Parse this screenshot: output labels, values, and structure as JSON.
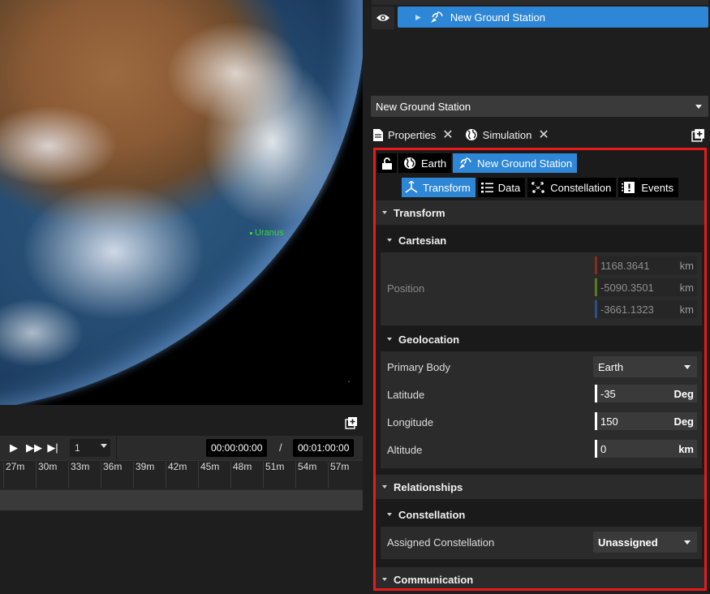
{
  "viewport": {
    "body_label": "Uranus"
  },
  "timeline": {
    "speed": "1",
    "current_time": "00:00:00:00",
    "end_time": "00:01:00:00",
    "ticks": [
      "27m",
      "30m",
      "33m",
      "36m",
      "39m",
      "42m",
      "45m",
      "48m",
      "51m",
      "54m",
      "57m"
    ]
  },
  "scene_tree": {
    "selected_item": "New Ground Station"
  },
  "object_selector": {
    "value": "New Ground Station"
  },
  "tabs": [
    {
      "label": "Properties"
    },
    {
      "label": "Simulation"
    }
  ],
  "breadcrumb": {
    "parent": "Earth",
    "current": "New Ground Station"
  },
  "subtabs": [
    {
      "label": "Transform"
    },
    {
      "label": "Data"
    },
    {
      "label": "Constellation"
    },
    {
      "label": "Events"
    }
  ],
  "transform": {
    "title": "Transform",
    "cartesian": {
      "title": "Cartesian",
      "position_label": "Position",
      "x": "1168.3641",
      "y": "-5090.3501",
      "z": "-3661.1323",
      "unit": "km"
    },
    "geolocation": {
      "title": "Geolocation",
      "primary_body_label": "Primary Body",
      "primary_body": "Earth",
      "latitude_label": "Latitude",
      "latitude": "-35",
      "latitude_unit": "Deg",
      "longitude_label": "Longitude",
      "longitude": "150",
      "longitude_unit": "Deg",
      "altitude_label": "Altitude",
      "altitude": "0",
      "altitude_unit": "km"
    }
  },
  "relationships": {
    "title": "Relationships",
    "constellation": {
      "title": "Constellation",
      "assigned_label": "Assigned Constellation",
      "assigned": "Unassigned"
    }
  },
  "communication": {
    "title": "Communication"
  },
  "colors": {
    "accent": "#2d86d6",
    "highlight_border": "#e81b1b",
    "x_axis": "#8b2a1c",
    "y_axis": "#5a7a1e",
    "z_axis": "#2a4f8a",
    "uranus_label": "#38d53a"
  }
}
